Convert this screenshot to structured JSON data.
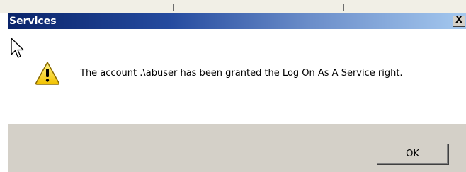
{
  "dialog": {
    "title": "Services",
    "close_label": "X",
    "message": "The account .\\abuser has been granted the Log On As A Service right.",
    "ok_label": "OK",
    "icon": "warning-icon"
  },
  "colors": {
    "titlebar_start": "#0a246a",
    "titlebar_end": "#a6caf0",
    "dialog_face": "#d4d0c8"
  }
}
